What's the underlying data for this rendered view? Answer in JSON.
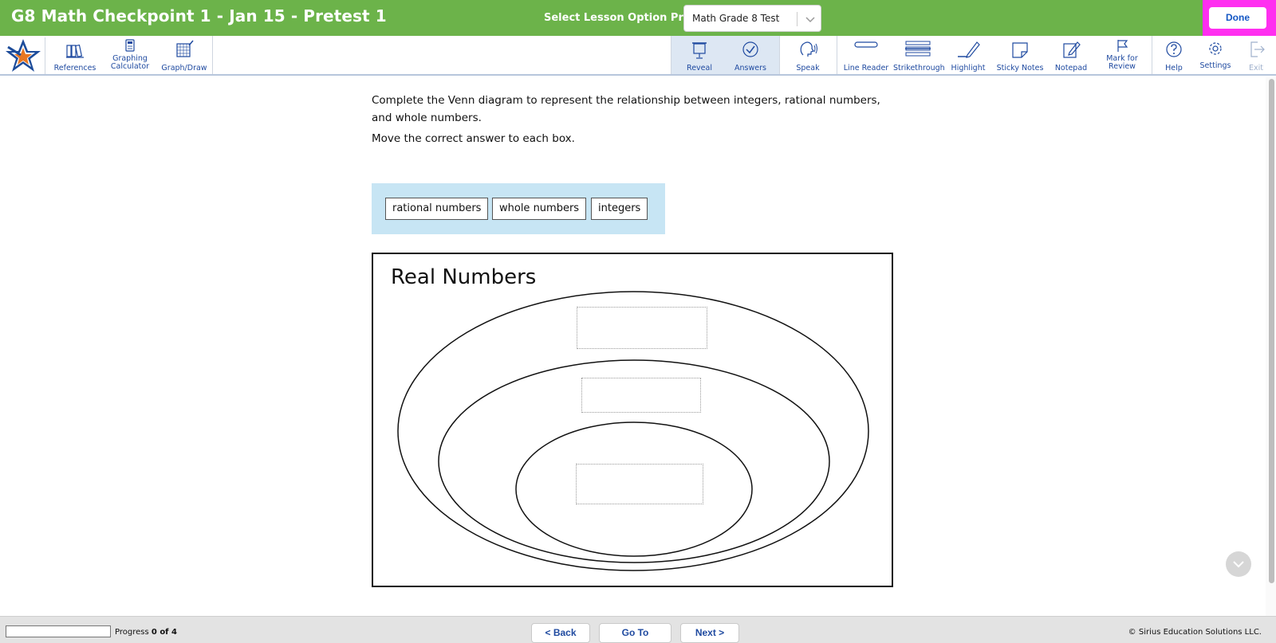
{
  "header": {
    "title": "G8 Math Checkpoint 1 - Jan 15 - Pretest 1",
    "profile_label": "Select Lesson Option Profile:",
    "profile_value": "Math Grade 8 Test",
    "done_label": "Done"
  },
  "toolbar": {
    "left_tools": [
      {
        "label": "References",
        "icon": "books-icon"
      },
      {
        "label": "Graphing Calculator",
        "icon": "calculator-icon"
      },
      {
        "label": "Graph/Draw",
        "icon": "graph-grid-icon"
      }
    ],
    "right_tools": [
      {
        "label": "Reveal",
        "icon": "reveal-icon"
      },
      {
        "label": "Answers",
        "icon": "check-circle-icon"
      },
      {
        "label": "Speak",
        "icon": "speak-icon"
      },
      {
        "label": "Line Reader",
        "icon": "line-reader-icon"
      },
      {
        "label": "Strikethrough",
        "icon": "strikethrough-icon"
      },
      {
        "label": "Highlight",
        "icon": "highlight-pen-icon"
      },
      {
        "label": "Sticky Notes",
        "icon": "sticky-note-icon"
      },
      {
        "label": "Notepad",
        "icon": "notepad-icon"
      },
      {
        "label": "Mark for Review",
        "icon": "flag-icon"
      },
      {
        "label": "Help",
        "icon": "help-icon"
      },
      {
        "label": "Settings",
        "icon": "gear-icon"
      },
      {
        "label": "Exit",
        "icon": "exit-icon"
      }
    ]
  },
  "question": {
    "prompt": "Complete the Venn diagram to represent the relationship between integers, rational numbers, and whole numbers.",
    "instruction": "Move the correct answer to each box.",
    "answer_choices": [
      "rational numbers",
      "whole numbers",
      "integers"
    ],
    "venn_title": "Real Numbers"
  },
  "footer": {
    "progress_label": "Progress",
    "progress_value": "0 of 4",
    "progress_fraction": 0,
    "back_label": "< Back",
    "goto_label": "Go To",
    "next_label": "Next >",
    "copyright": "© Sirius Education Solutions LLC."
  },
  "colors": {
    "header_green": "#6cb34a",
    "done_highlight": "#ff2ff0",
    "toolbar_text": "#1f4aa0",
    "answer_bank_bg": "#c7e5f4"
  }
}
